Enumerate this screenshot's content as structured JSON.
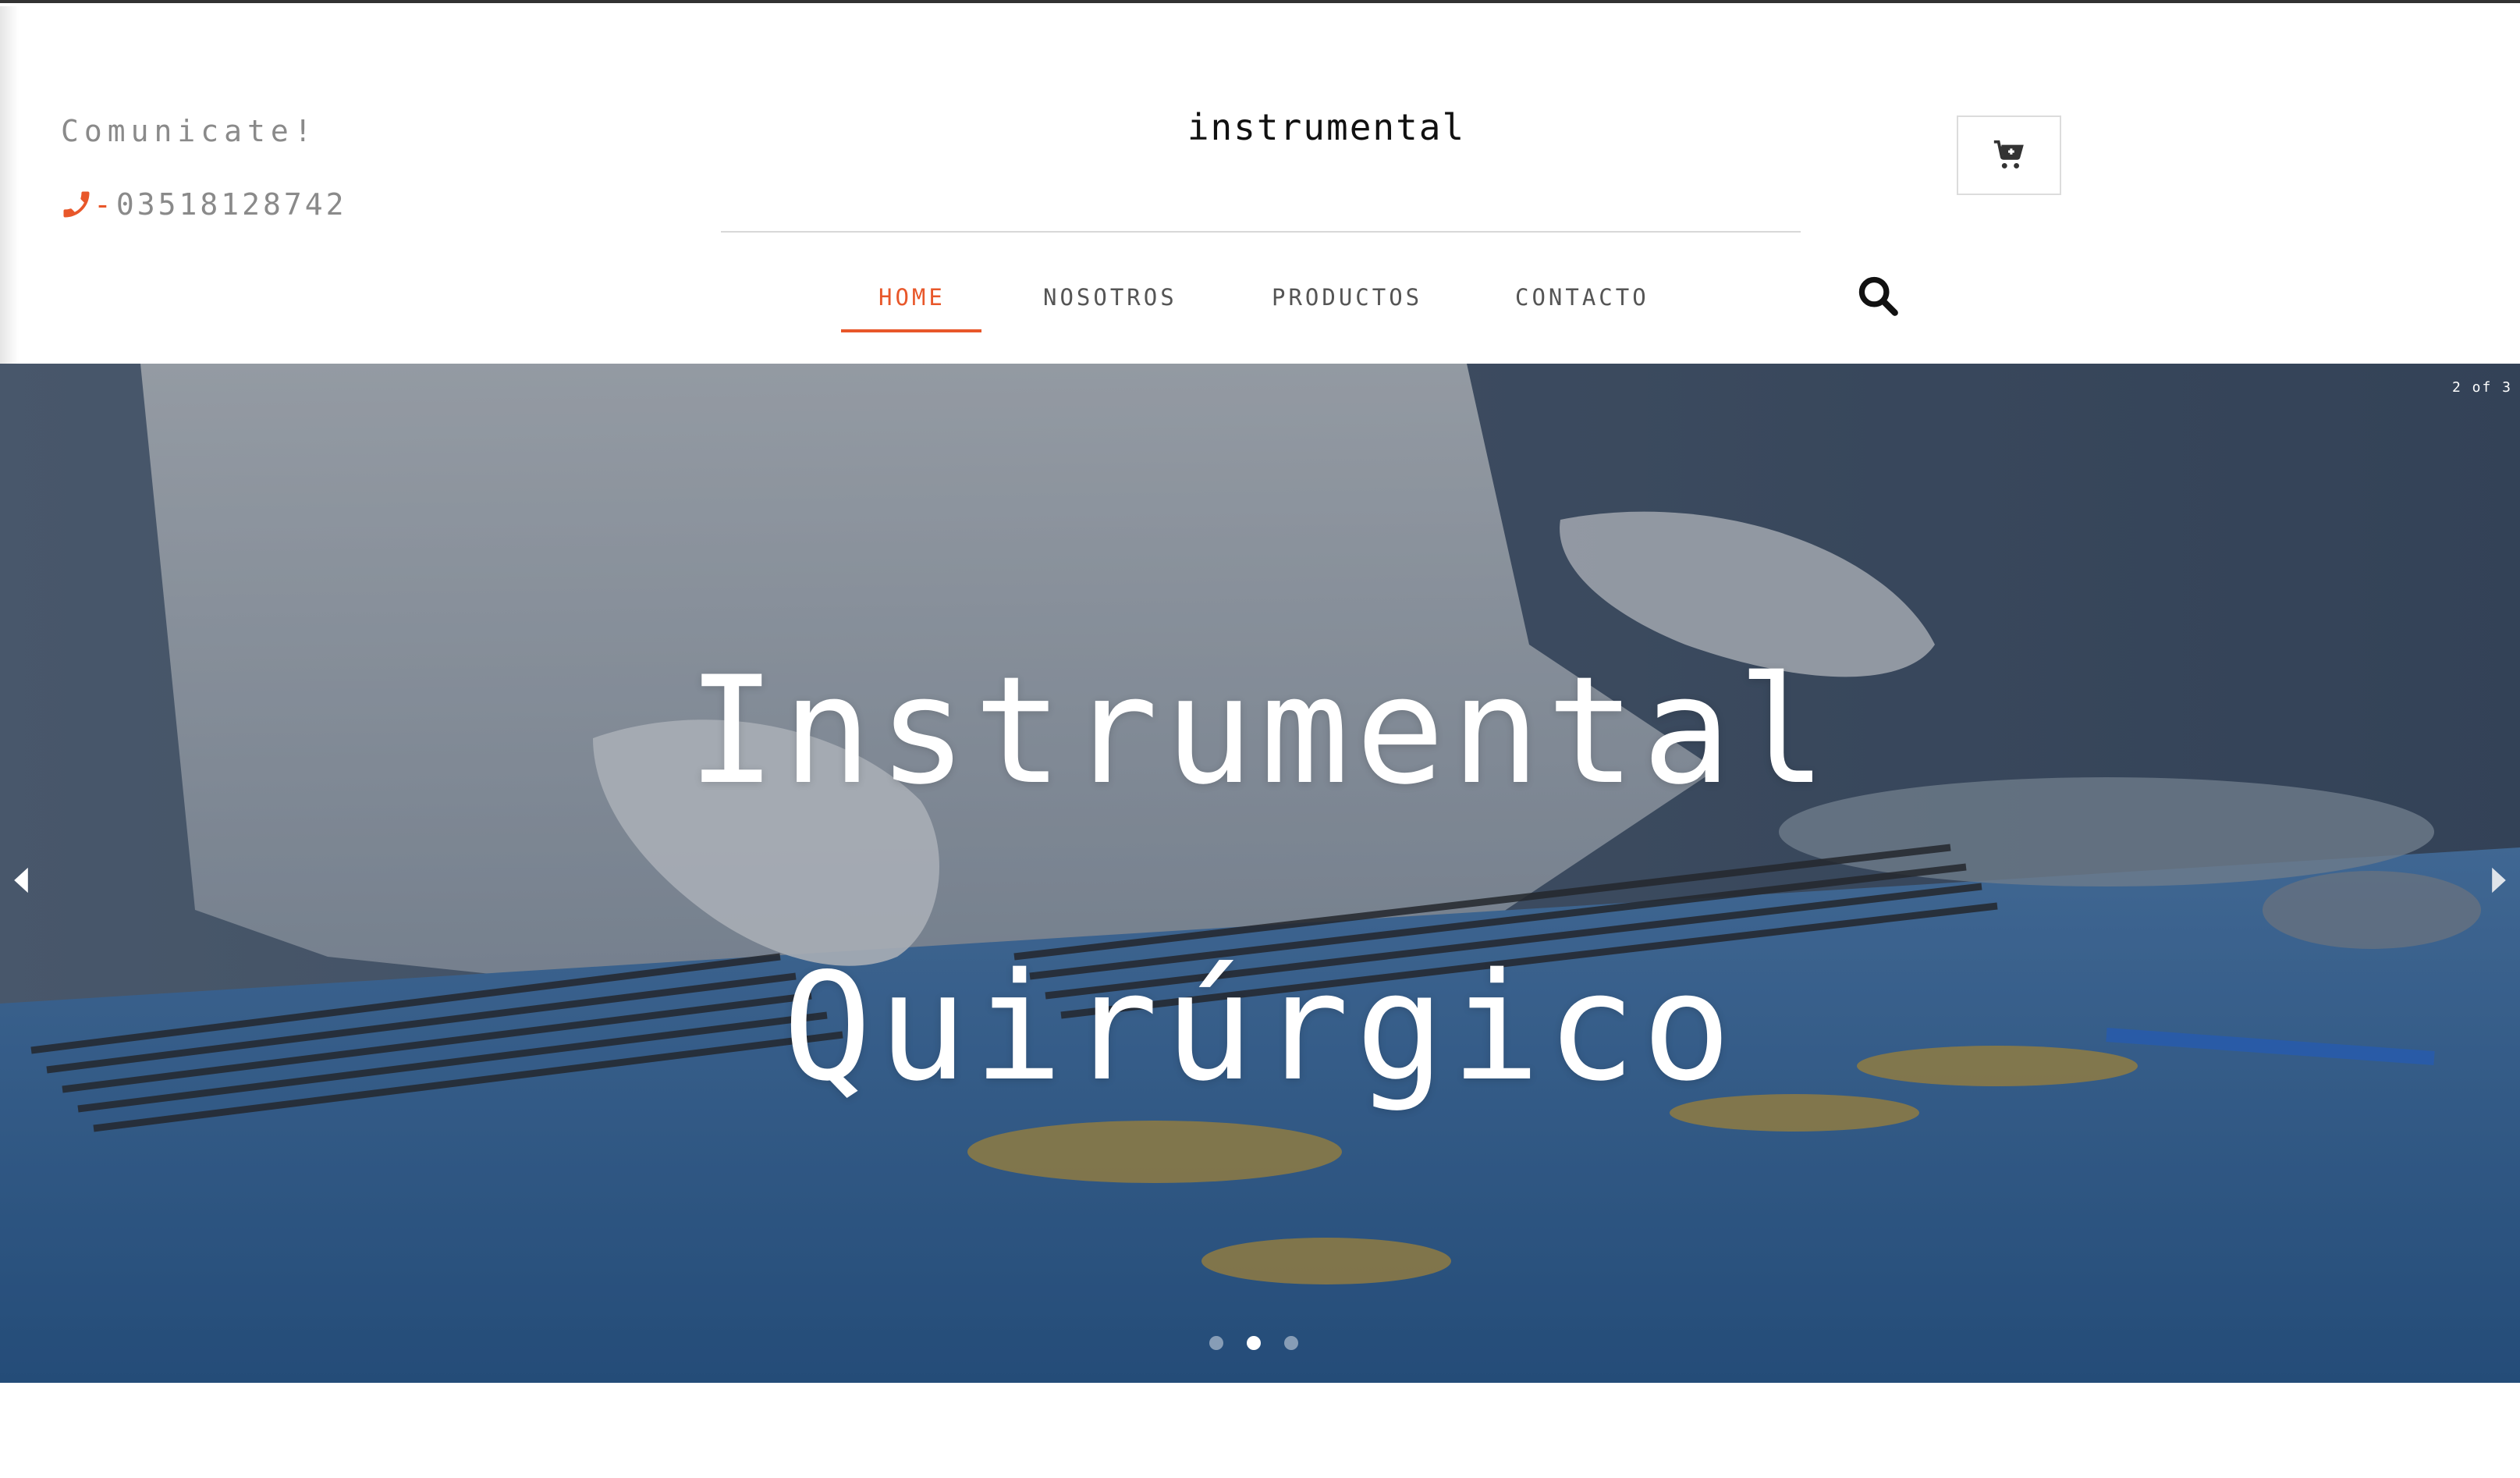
{
  "header": {
    "contact_title": "Comunicate!",
    "phone": "03518128742",
    "phone_prefix": "-",
    "brand": "instrumental",
    "cart_icon": "cart-plus-icon",
    "search_icon": "search-icon"
  },
  "nav": {
    "items": [
      {
        "label": "HOME",
        "active": true
      },
      {
        "label": "NOSOTROS",
        "active": false
      },
      {
        "label": "PRODUCTOS",
        "active": false
      },
      {
        "label": "CONTACTO",
        "active": false
      }
    ]
  },
  "hero": {
    "counter": "2 of 3",
    "title_line1": "Instrumental",
    "title_line2": "Quirúrgico",
    "slides_total": 3,
    "active_slide": 2
  },
  "colors": {
    "accent": "#e8572a",
    "text_muted": "#8a8a8a"
  }
}
